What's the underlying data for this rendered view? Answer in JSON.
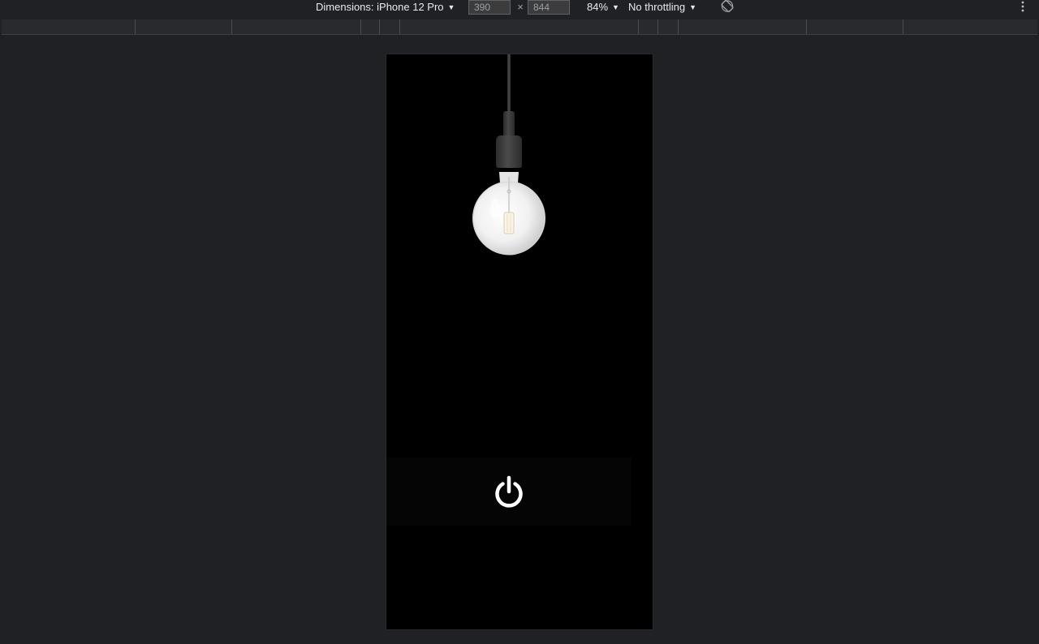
{
  "toolbar": {
    "dimensions_label": "Dimensions: iPhone 12 Pro",
    "width_value": "390",
    "height_value": "844",
    "times_symbol": "×",
    "zoom_label": "84%",
    "throttling_label": "No throttling"
  },
  "icons": {
    "rotate": "rotate-device-icon",
    "more": "more-options-icon",
    "power": "power-icon",
    "bulb": "light-bulb-icon"
  },
  "colors": {
    "devtools_background": "#202124",
    "toolbar_text": "#e8eaed",
    "viewport_background": "#000000",
    "power_icon": "#ffffff"
  },
  "app": {
    "light_state": "off"
  }
}
